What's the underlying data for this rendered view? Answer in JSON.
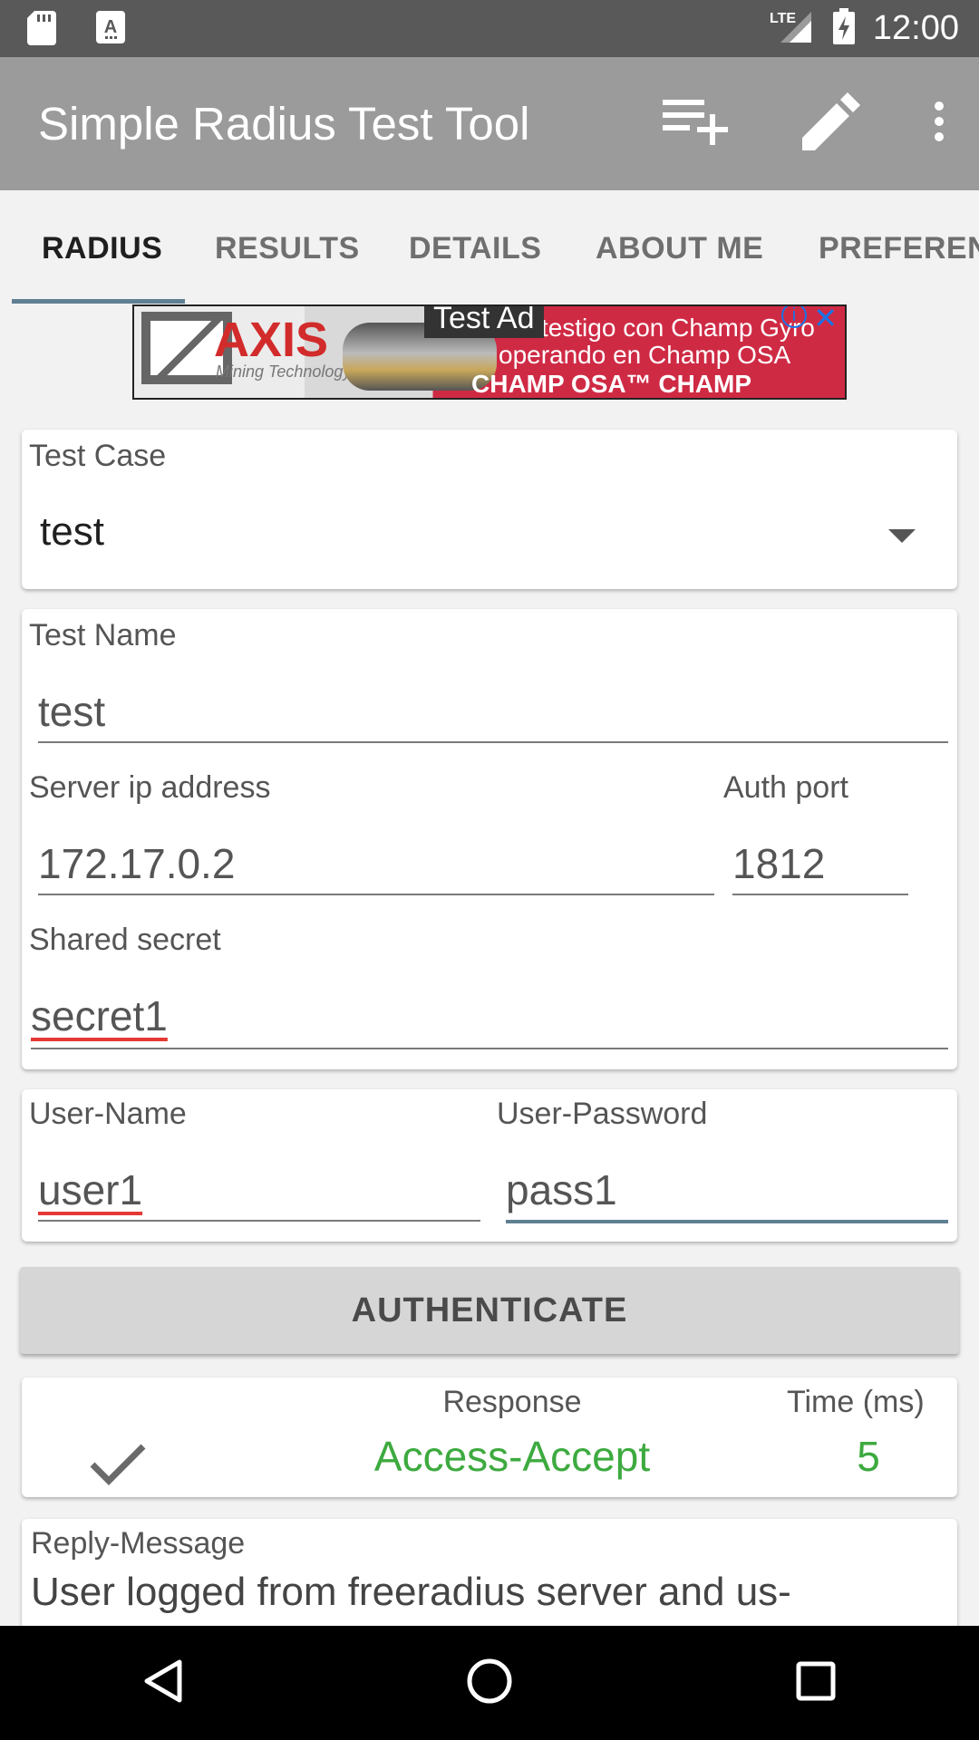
{
  "status_bar": {
    "time": "12:00",
    "network": "LTE",
    "icons": [
      "sd-card-icon",
      "text-notification-icon",
      "signal-icon",
      "battery-charging-icon"
    ]
  },
  "app_bar": {
    "title": "Simple Radius Test Tool",
    "actions": [
      "add-to-list-icon",
      "edit-pencil-icon",
      "overflow-menu-icon"
    ]
  },
  "tabs": [
    {
      "label": "RADIUS",
      "active": true
    },
    {
      "label": "RESULTS",
      "active": false
    },
    {
      "label": "DETAILS",
      "active": false
    },
    {
      "label": "ABOUT ME",
      "active": false
    },
    {
      "label": "PREFEREN",
      "active": false
    }
  ],
  "ad": {
    "badge": "Test Ad",
    "brand": "AXIS",
    "brand_sub": "Mining Technology",
    "line1": "de testigo con Champ Gyro",
    "line2": "operando en Champ OSA",
    "line3": "CHAMP OSA™ CHAMP GYRO™"
  },
  "test_case": {
    "label": "Test Case",
    "selected": "test"
  },
  "server_card": {
    "test_name_label": "Test Name",
    "test_name_value": "test",
    "server_ip_label": "Server ip address",
    "server_ip_value": "172.17.0.2",
    "auth_port_label": "Auth port",
    "auth_port_value": "1812",
    "secret_label": "Shared secret",
    "secret_value": "secret1"
  },
  "credentials": {
    "username_label": "User-Name",
    "username_value": "user1",
    "password_label": "User-Password",
    "password_value": "pass1"
  },
  "authenticate_label": "AUTHENTICATE",
  "result": {
    "response_label": "Response",
    "response_value": "Access-Accept",
    "time_label": "Time (ms)",
    "time_value": "5",
    "status_icon": "checkmark-icon",
    "accent_color": "#3daa3f"
  },
  "reply": {
    "label": "Reply-Message",
    "value": "User logged from freeradius server and us-"
  },
  "nav_bar": [
    "back-icon",
    "home-icon",
    "recents-icon"
  ]
}
